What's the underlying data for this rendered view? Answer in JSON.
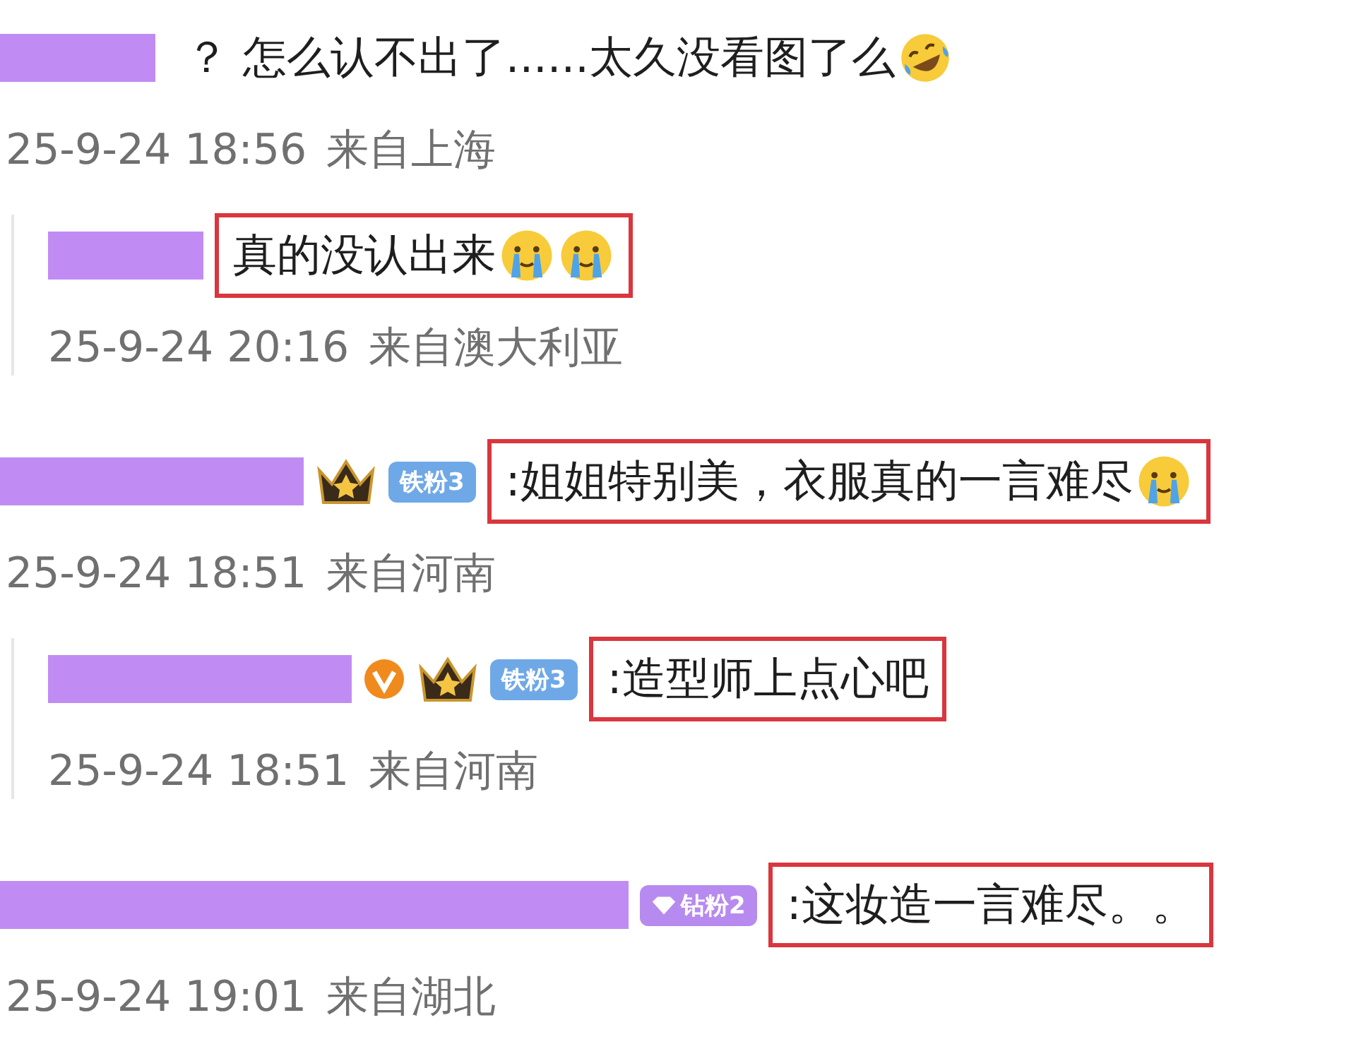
{
  "comments": [
    {
      "kind": "short-name",
      "text": "？ 怎么认不出了......太久没看图了么",
      "emojis": [
        {
          "kind": "laughing-tears"
        }
      ],
      "highlighted": false,
      "time": "25-9-24 18:56",
      "location": "来自上海",
      "replies": [
        {
          "kind": "short-name",
          "text": "真的没认出来",
          "emojis": [
            {
              "kind": "crying"
            },
            {
              "kind": "crying"
            }
          ],
          "highlighted": true,
          "time": "25-9-24 20:16",
          "location": "来自澳大利亚"
        }
      ]
    },
    {
      "kind": "medium-name",
      "badges": [
        {
          "kind": "crown"
        },
        {
          "kind": "fan",
          "label": "铁粉3",
          "color": "#6fa8e6"
        }
      ],
      "text": ":姐姐特别美，衣服真的一言难尽",
      "emojis": [
        {
          "kind": "crying"
        }
      ],
      "highlighted": true,
      "time": "25-9-24 18:51",
      "location": "来自河南",
      "replies": [
        {
          "kind": "medium-name",
          "badges": [
            {
              "kind": "verified"
            },
            {
              "kind": "crown"
            },
            {
              "kind": "fan",
              "label": "铁粉3",
              "color": "#6fa8e6"
            }
          ],
          "text": ":造型师上点心吧",
          "highlighted": true,
          "time": "25-9-24 18:51",
          "location": "来自河南"
        }
      ]
    },
    {
      "kind": "long-name",
      "badges": [
        {
          "kind": "diamond-fan",
          "label": "钻粉2",
          "color": "#b78af0"
        }
      ],
      "text": ":这妆造一言难尽。。",
      "highlighted": true,
      "time": "25-9-24 19:01",
      "location": "来自湖北"
    }
  ]
}
